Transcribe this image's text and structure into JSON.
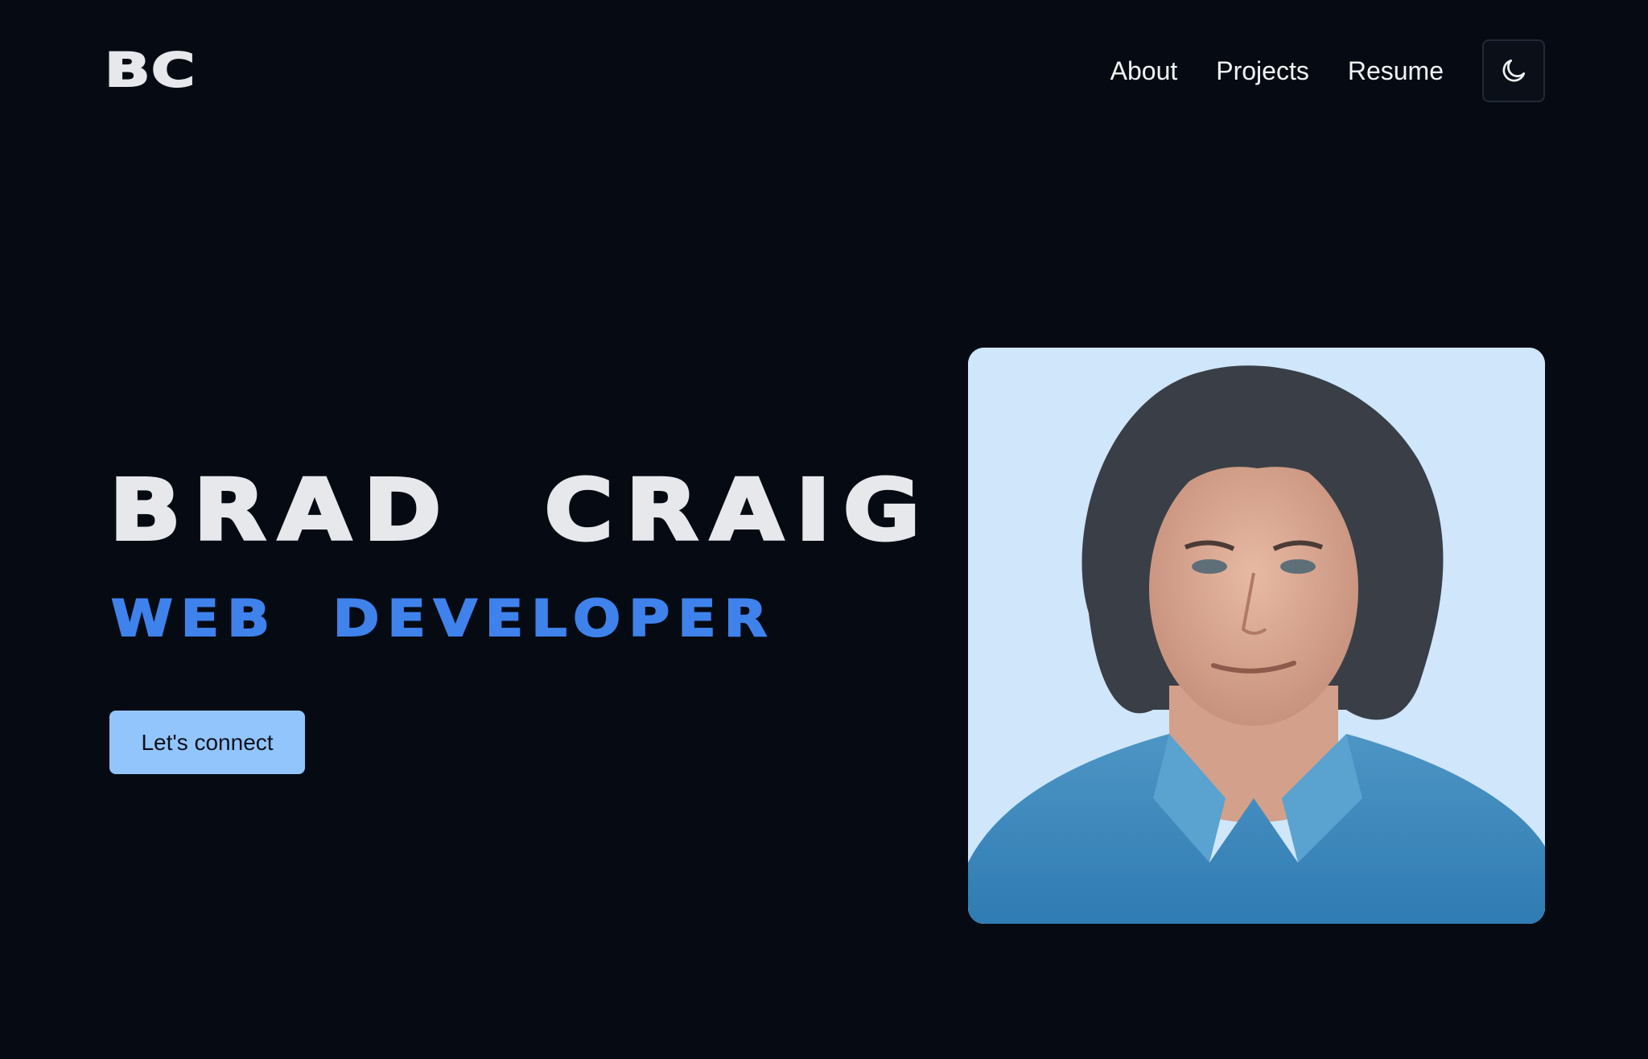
{
  "header": {
    "logo_text": "BC",
    "nav": [
      {
        "label": "About"
      },
      {
        "label": "Projects"
      },
      {
        "label": "Resume"
      }
    ],
    "theme_toggle_icon": "moon-icon"
  },
  "hero": {
    "name": "BRAD  CRAIG",
    "role": "WEB  DEVELOPER",
    "cta_label": "Let's connect",
    "portrait_icon": "portrait-photo"
  },
  "colors": {
    "background": "#060b13",
    "heading": "#e6e8eb",
    "accent": "#3f82ec",
    "cta": "#93c5fd",
    "photo_background": "#cfe6fb"
  }
}
